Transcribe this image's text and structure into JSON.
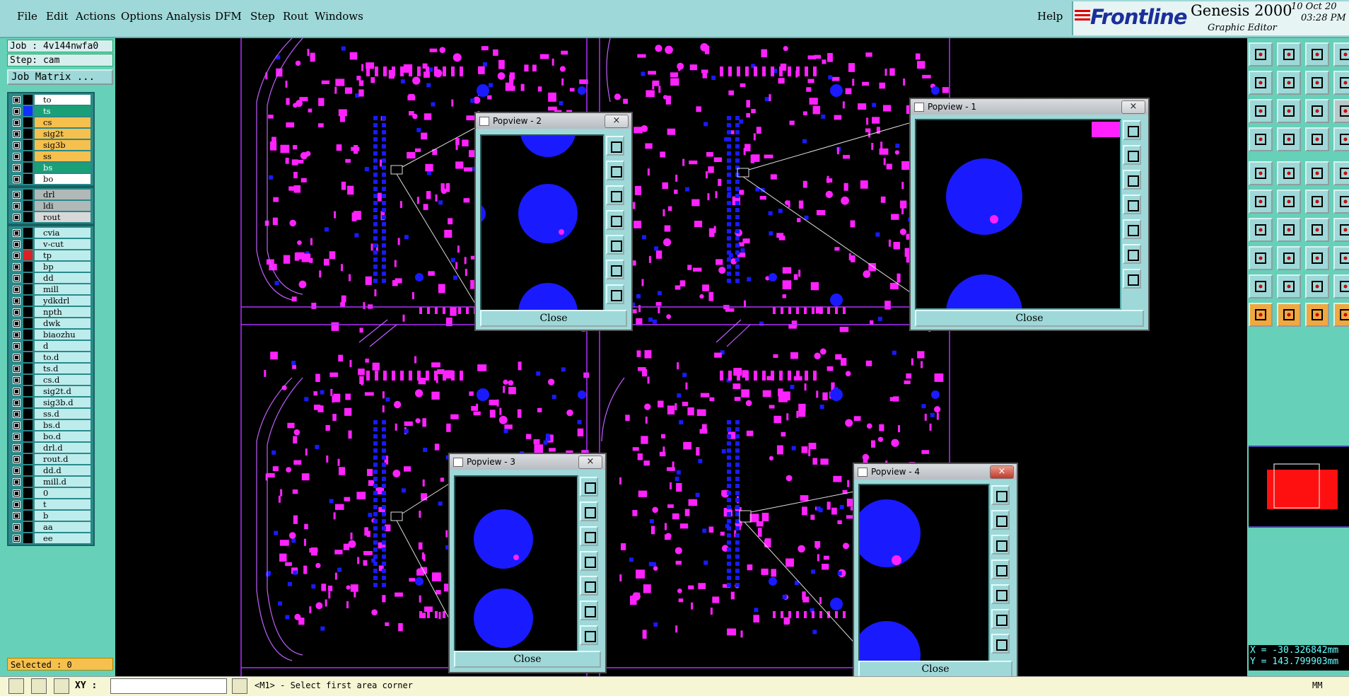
{
  "menu": {
    "items": [
      {
        "label": "File",
        "x": 0
      },
      {
        "label": "Edit"
      },
      {
        "label": "Actions"
      },
      {
        "label": "Options"
      },
      {
        "label": "Analysis"
      },
      {
        "label": "DFM"
      },
      {
        "label": "Step"
      },
      {
        "label": "Rout"
      },
      {
        "label": "Windows"
      }
    ],
    "help": "Help"
  },
  "brand": {
    "logo": "Frontline",
    "product": "Genesis 2000",
    "subtitle": "Graphic Editor",
    "date": "10 Oct 20",
    "time": "03:28 PM"
  },
  "job": {
    "job_label": "Job : 4v144nwfa0",
    "step_label": "Step: cam",
    "matrix_button": "Job Matrix ..."
  },
  "layers": {
    "board": [
      {
        "name": "to",
        "color": "#000000",
        "bg": "#ffffff"
      },
      {
        "name": "ts",
        "color": "#1030ff",
        "bg": "#1aa077"
      },
      {
        "name": "cs",
        "color": "#000000",
        "bg": "#f6c04e"
      },
      {
        "name": "sig2t",
        "color": "#000000",
        "bg": "#f6c04e"
      },
      {
        "name": "sig3b",
        "color": "#000000",
        "bg": "#f6c04e"
      },
      {
        "name": "ss",
        "color": "#000000",
        "bg": "#f6c04e"
      },
      {
        "name": "bs",
        "color": "#000000",
        "bg": "#1aa077"
      },
      {
        "name": "bo",
        "color": "#000000",
        "bg": "#ffffff"
      }
    ],
    "drill": [
      {
        "name": "drl",
        "color": "#000000",
        "bg": "#b0b8b8"
      },
      {
        "name": "ldi",
        "color": "#000000",
        "bg": "#b0b8b8"
      },
      {
        "name": "rout",
        "color": "#000000",
        "bg": "#d8d8d8"
      }
    ],
    "misc": [
      {
        "name": "cvia",
        "color": "#000000"
      },
      {
        "name": "v-cut",
        "color": "#000000"
      },
      {
        "name": "tp",
        "color": "#e02020"
      },
      {
        "name": "bp",
        "color": "#000000"
      },
      {
        "name": "dd",
        "color": "#000000"
      },
      {
        "name": "mill",
        "color": "#000000"
      },
      {
        "name": "ydkdrl",
        "color": "#000000"
      },
      {
        "name": "npth",
        "color": "#000000"
      },
      {
        "name": "dwk",
        "color": "#000000"
      },
      {
        "name": "biaozhu",
        "color": "#000000"
      },
      {
        "name": "d",
        "color": "#000000"
      },
      {
        "name": "to.d",
        "color": "#000000"
      },
      {
        "name": "ts.d",
        "color": "#000000"
      },
      {
        "name": "cs.d",
        "color": "#000000"
      },
      {
        "name": "sig2t.d",
        "color": "#000000"
      },
      {
        "name": "sig3b.d",
        "color": "#000000"
      },
      {
        "name": "ss.d",
        "color": "#000000"
      },
      {
        "name": "bs.d",
        "color": "#000000"
      },
      {
        "name": "bo.d",
        "color": "#000000"
      },
      {
        "name": "drl.d",
        "color": "#000000"
      },
      {
        "name": "rout.d",
        "color": "#000000"
      },
      {
        "name": "dd.d",
        "color": "#000000"
      },
      {
        "name": "mill.d",
        "color": "#000000"
      },
      {
        "name": "0",
        "color": "#000000"
      },
      {
        "name": "t",
        "color": "#000000"
      },
      {
        "name": "b",
        "color": "#000000"
      },
      {
        "name": "aa",
        "color": "#000000"
      },
      {
        "name": "ee",
        "color": "#000000"
      }
    ]
  },
  "selected": "Selected : 0",
  "popviews": [
    {
      "title": "Popview - 2",
      "close": "Close",
      "close_x": "×"
    },
    {
      "title": "Popview - 1",
      "close": "Close",
      "close_x": "×"
    },
    {
      "title": "Popview - 3",
      "close": "Close",
      "close_x": "×"
    },
    {
      "title": "Popview - 4",
      "close": "Close",
      "close_x": "×"
    }
  ],
  "coordinates": {
    "x": "X = -30.326842mm",
    "y": "Y = 143.799903mm"
  },
  "statusbar": {
    "xy_label": "XY :",
    "xy_value": "",
    "prompt": "<M1> - Select first area corner",
    "units": "MM"
  },
  "colors": {
    "pad": "#ff22ff",
    "via": "#1a1aff",
    "panel": "#66d0b8",
    "menubar": "#9fd8d8"
  }
}
